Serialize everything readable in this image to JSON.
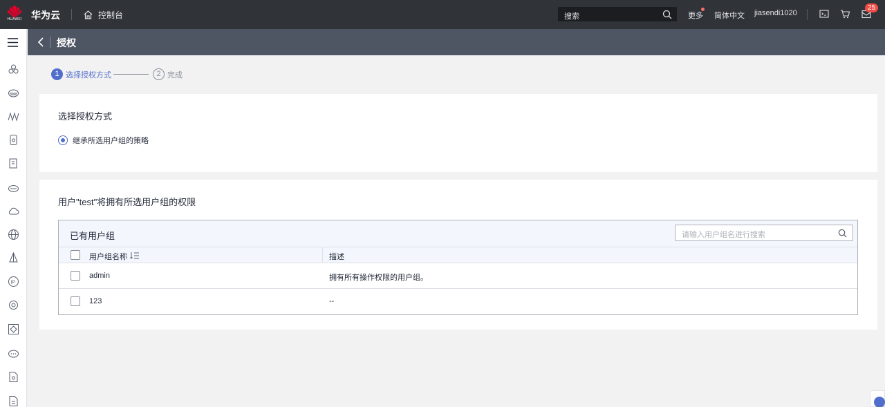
{
  "topbar": {
    "logo_text": "HUAWEI",
    "brand": "华为云",
    "console_label": "控制台",
    "search_placeholder": "搜索",
    "more_label": "更多",
    "language_label": "简体中文",
    "username": "jiasendi1020",
    "message_count": "25"
  },
  "titlebar": {
    "title": "授权"
  },
  "steps": [
    {
      "num": "1",
      "label": "选择授权方式"
    },
    {
      "num": "2",
      "label": "完成"
    }
  ],
  "auth_method": {
    "title": "选择授权方式",
    "option": "继承所选用户组的策略"
  },
  "groups": {
    "title": "用户\"test\"将拥有所选用户组的权限",
    "panel_title": "已有用户组",
    "search_placeholder": "请输入用户组名进行搜索",
    "columns": [
      "用户组名称",
      "描述"
    ],
    "rows": [
      {
        "name": "admin",
        "desc": "拥有所有操作权限的用户组。"
      },
      {
        "name": "123",
        "desc": "--"
      }
    ]
  },
  "colors": {
    "topbar": "#303338",
    "titlebar": "#4e5563",
    "accent": "#526ecc",
    "badge": "#f04c45"
  }
}
